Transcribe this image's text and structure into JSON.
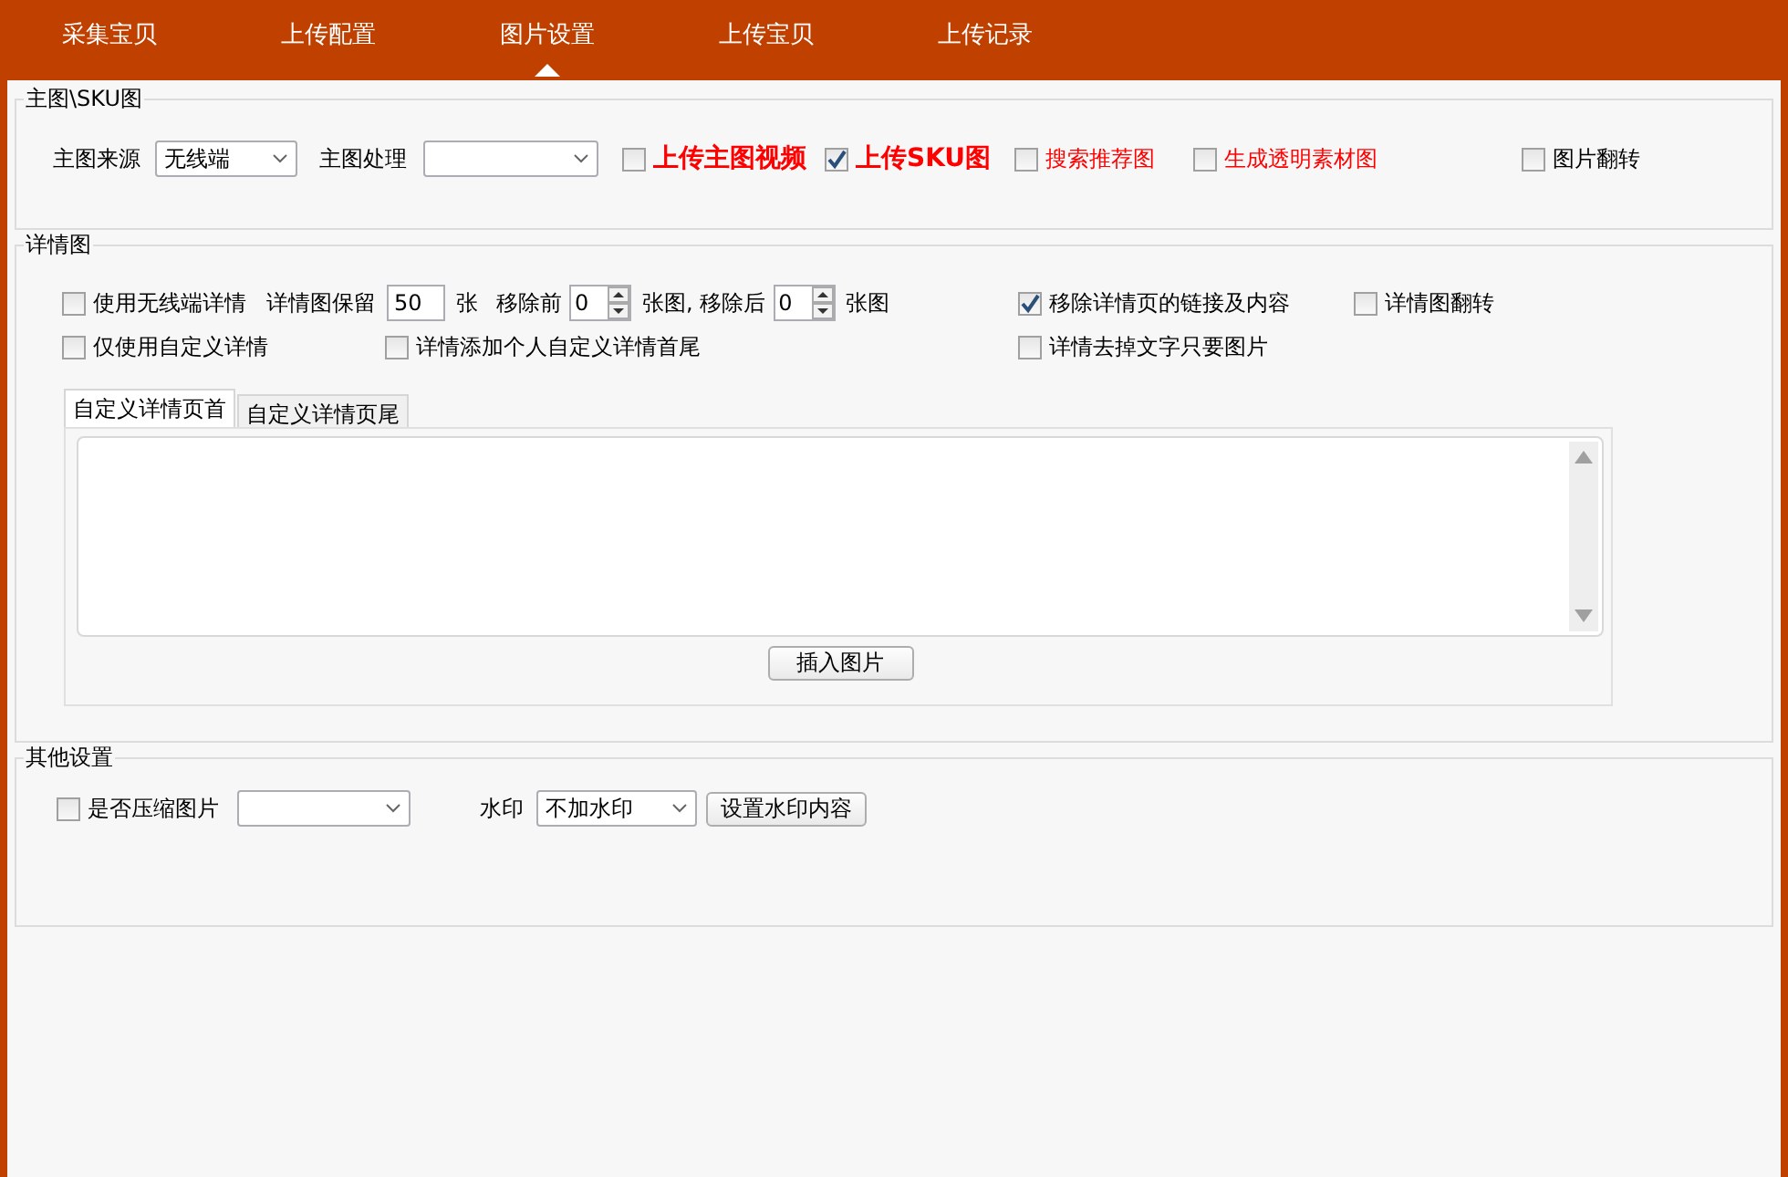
{
  "nav_tabs": [
    {
      "label": "采集宝贝",
      "selected": false
    },
    {
      "label": "上传配置",
      "selected": false
    },
    {
      "label": "图片设置",
      "selected": true
    },
    {
      "label": "上传宝贝",
      "selected": false
    },
    {
      "label": "上传记录",
      "selected": false
    }
  ],
  "main_image": {
    "title": "主图\\SKU图",
    "source": {
      "label": "主图来源",
      "value": "无线端"
    },
    "processing": {
      "label": "主图处理"
    },
    "options": [
      {
        "label": "上传主图视频",
        "checked": false,
        "kind": "strong"
      },
      {
        "label": "上传SKU图",
        "checked": true,
        "kind": "strong"
      },
      {
        "label": "搜索推荐图",
        "checked": false,
        "kind": "red"
      },
      {
        "label": "生成透明素材图",
        "checked": false,
        "kind": "red"
      },
      {
        "label": "图片翻转",
        "checked": false,
        "kind": "plain"
      }
    ]
  },
  "detail_images": {
    "title": "详情图",
    "top_checkboxes": [
      {
        "label": "使用无线端详情",
        "checked": false
      },
      {
        "label": "移除详情页的链接及内容",
        "checked": true
      },
      {
        "label": "详情图翻转",
        "checked": false
      }
    ],
    "counters": [
      {
        "kind": "text",
        "text": "详情图保留"
      },
      {
        "kind": "input",
        "value": "50"
      },
      {
        "kind": "text",
        "text": "张"
      },
      {
        "kind": "text",
        "text": "移除前"
      },
      {
        "kind": "spinner",
        "value": "0"
      },
      {
        "kind": "text",
        "text": "张图, 移除后"
      },
      {
        "kind": "spinner",
        "value": "0"
      },
      {
        "kind": "text",
        "text": "张图"
      }
    ],
    "bottom_checkboxes": [
      {
        "label": "仅使用自定义详情",
        "checked": false
      },
      {
        "label": "详情添加个人自定义详情首尾",
        "checked": false
      },
      {
        "label": "详情去掉文字只要图片",
        "checked": false
      }
    ],
    "editor_tabs": [
      {
        "label": "自定义详情页首",
        "selected": true
      },
      {
        "label": "自定义详情页尾",
        "selected": false
      }
    ],
    "insert_button": "插入图片"
  },
  "other_settings": {
    "title": "其他设置",
    "compress": {
      "label": "是否压缩图片",
      "checked": false
    },
    "watermark": {
      "label": "水印",
      "value": "不加水印"
    },
    "watermark_button": "设置水印内容"
  }
}
